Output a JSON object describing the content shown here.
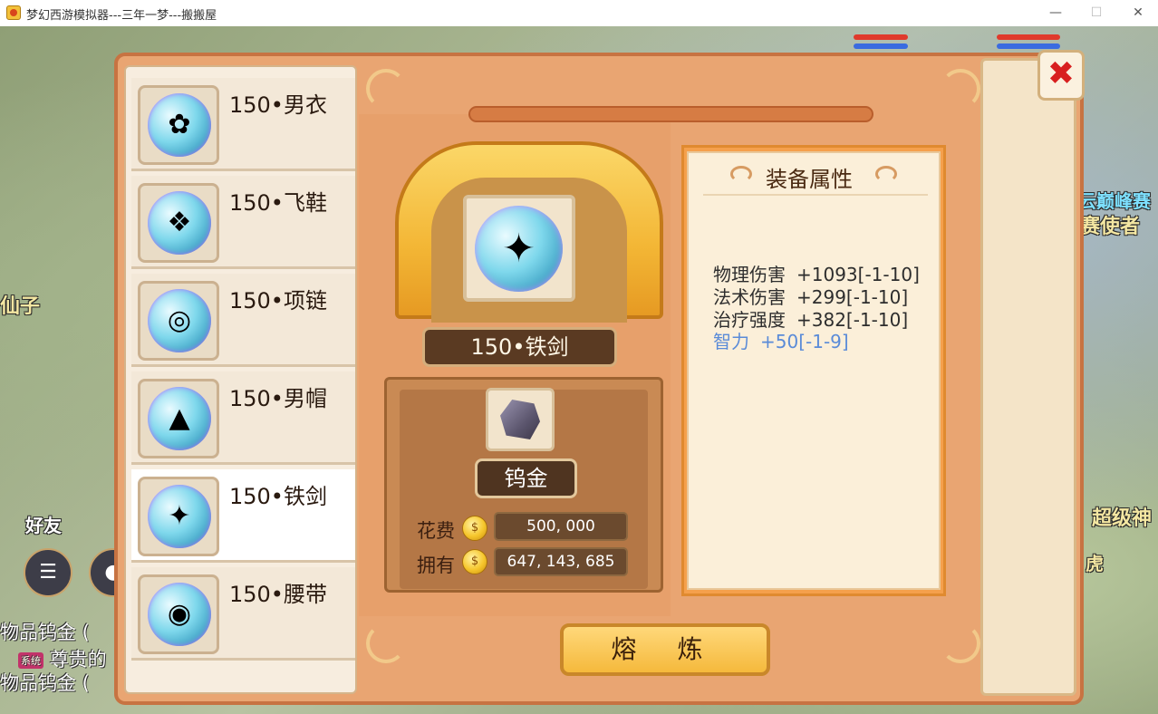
{
  "window": {
    "title": "梦幻西游模拟器---三年一梦---搬搬屋",
    "min_icon": "minimize-icon",
    "max_icon": "maximize-icon",
    "close_icon": "close-icon"
  },
  "background": {
    "labels": [
      "仙子",
      "云巅峰赛",
      "赛使者",
      "超级神",
      "虎"
    ],
    "buttons": [
      "好友"
    ],
    "chat": [
      {
        "tag": "系统",
        "text": "尊贵的"
      },
      {
        "text": "物品钨金  ("
      },
      {
        "text": "物品钨金  ("
      }
    ]
  },
  "equipment_list": [
    {
      "name": "150•男衣",
      "icon": "armor-icon",
      "selected": false
    },
    {
      "name": "150•飞鞋",
      "icon": "boots-icon",
      "selected": false
    },
    {
      "name": "150•项链",
      "icon": "necklace-icon",
      "selected": false
    },
    {
      "name": "150•男帽",
      "icon": "helmet-icon",
      "selected": false
    },
    {
      "name": "150•铁剑",
      "icon": "sword-icon",
      "selected": true
    },
    {
      "name": "150•腰带",
      "icon": "belt-icon",
      "selected": false
    }
  ],
  "forge": {
    "selected_item": "150•铁剑",
    "material": "钨金",
    "cost_label": "花费",
    "cost_value": "500, 000",
    "owned_label": "拥有",
    "owned_value": "647, 143, 685",
    "action_button": "熔 炼"
  },
  "attributes": {
    "title": "装备属性",
    "lines": [
      {
        "name": "物理伤害",
        "value": "+1093[-1-10]",
        "highlight": false
      },
      {
        "name": "法术伤害",
        "value": "+299[-1-10]",
        "highlight": false
      },
      {
        "name": "治疗强度",
        "value": "+382[-1-10]",
        "highlight": false
      },
      {
        "name": "智力",
        "value": "+50[-1-9]",
        "highlight": true
      }
    ]
  },
  "colors": {
    "panel": "#e9a572",
    "selected_row": "#ffffff",
    "highlight_attr": "#5a8bd8",
    "close_x": "#d81f1f"
  }
}
